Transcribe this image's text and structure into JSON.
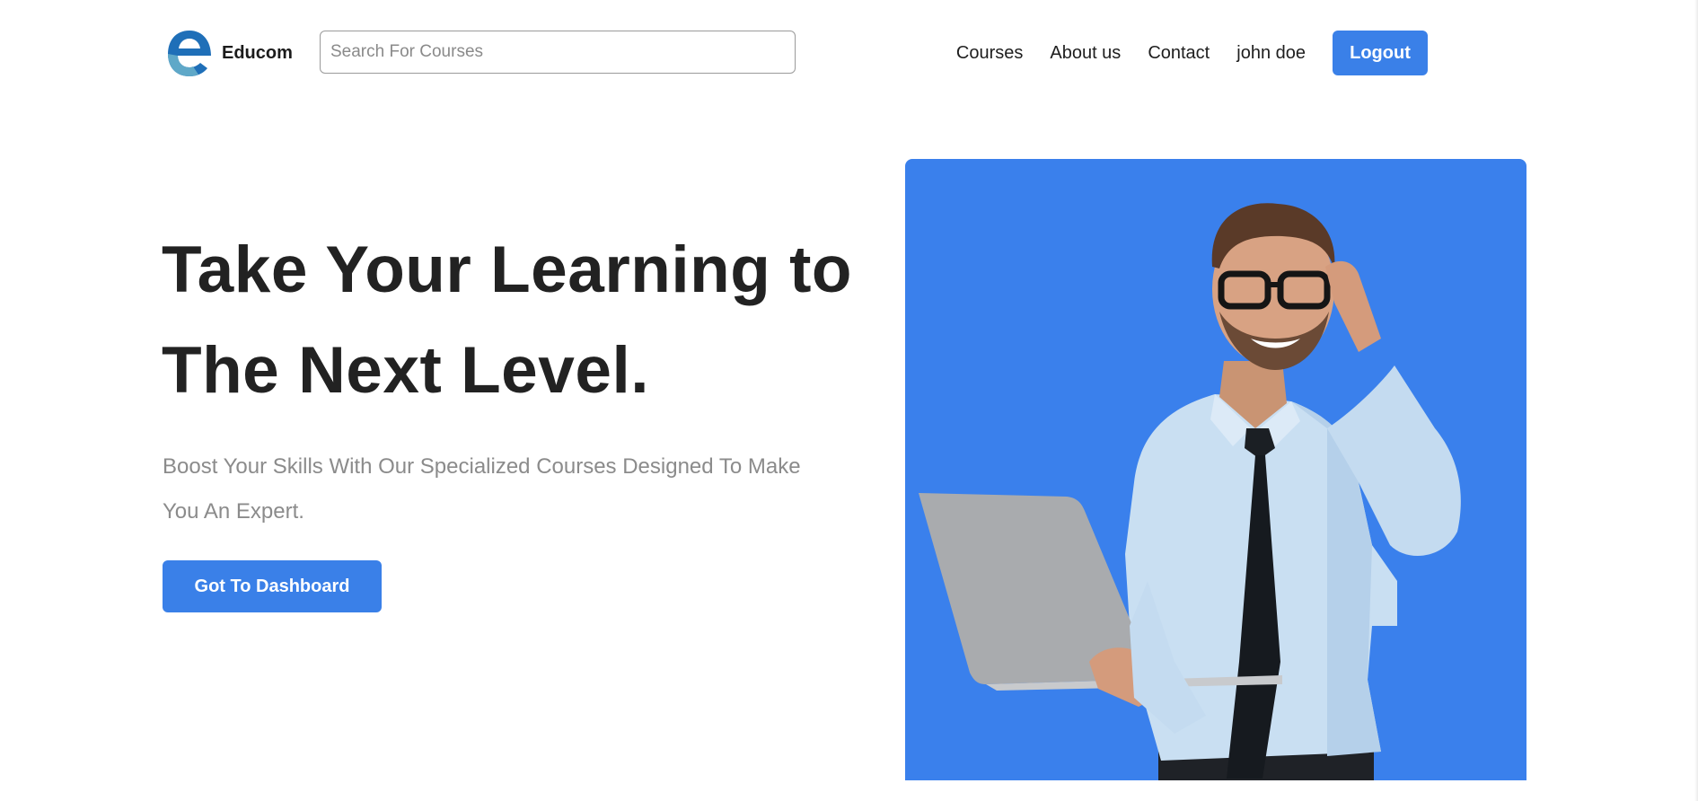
{
  "brand": {
    "name": "Educom",
    "logo_icon": "e-letter-logo-icon"
  },
  "search": {
    "placeholder": "Search For Courses",
    "value": ""
  },
  "nav": {
    "items": [
      {
        "label": "Courses"
      },
      {
        "label": "About us"
      },
      {
        "label": "Contact"
      },
      {
        "label": "john doe"
      }
    ],
    "logout_label": "Logout"
  },
  "hero": {
    "title_line1": "Take Your Learning to",
    "title_line2": "The Next Level.",
    "subtitle_line1": "Boost Your Skills With Our Specialized Courses Designed To Make",
    "subtitle_line2": "You An Expert.",
    "cta_label": "Got To Dashboard",
    "image": "man-with-laptop-photo"
  },
  "colors": {
    "accent": "#3a80e8",
    "image_background": "#3a80ec",
    "text_dark": "#222222",
    "text_muted": "#8b8b8b"
  }
}
